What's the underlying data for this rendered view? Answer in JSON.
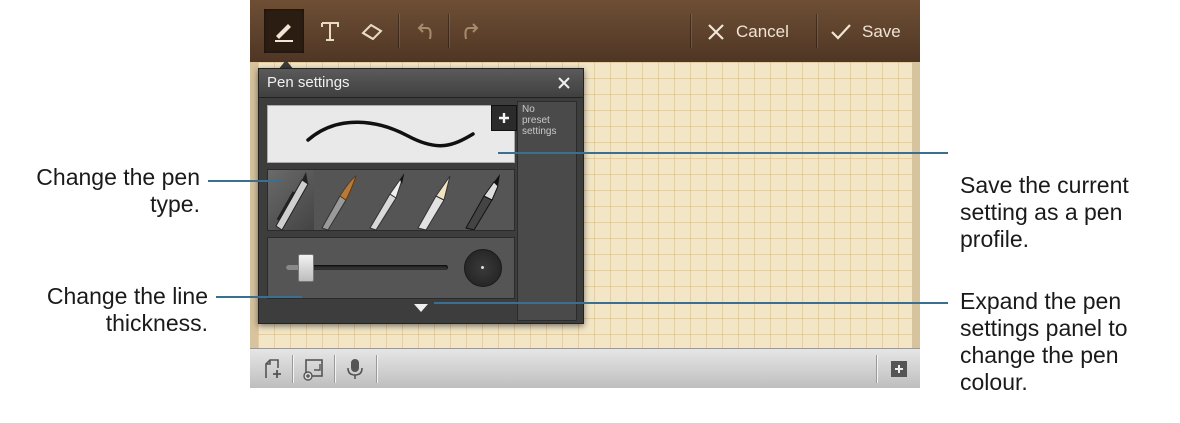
{
  "toolbar": {
    "cancel_label": "Cancel",
    "save_label": "Save",
    "icons": [
      "pen-icon",
      "text-icon",
      "eraser-icon",
      "undo-icon",
      "redo-icon"
    ]
  },
  "pen_settings": {
    "title": "Pen settings",
    "preset_text": "No\npreset\nsettings",
    "thickness_level": 0.12,
    "pen_types": [
      "pen",
      "brush",
      "pencil",
      "highlighter",
      "marker"
    ]
  },
  "bottom_bar": {
    "icons": [
      "add-page-icon",
      "insert-image-icon",
      "microphone-icon",
      "add-note-icon"
    ]
  },
  "annotations": {
    "pen_type": "Change the pen\ntype.",
    "line_thickness": "Change the line\nthickness.",
    "save_profile": "Save the current\nsetting as a pen\nprofile.",
    "expand_panel": "Expand the pen\nsettings panel to\nchange the pen\ncolour."
  },
  "colors": {
    "leader_line": "#3a6f92",
    "toolbar_brown": "#5a3f2a",
    "canvas_paper": "#f3e6c6"
  }
}
